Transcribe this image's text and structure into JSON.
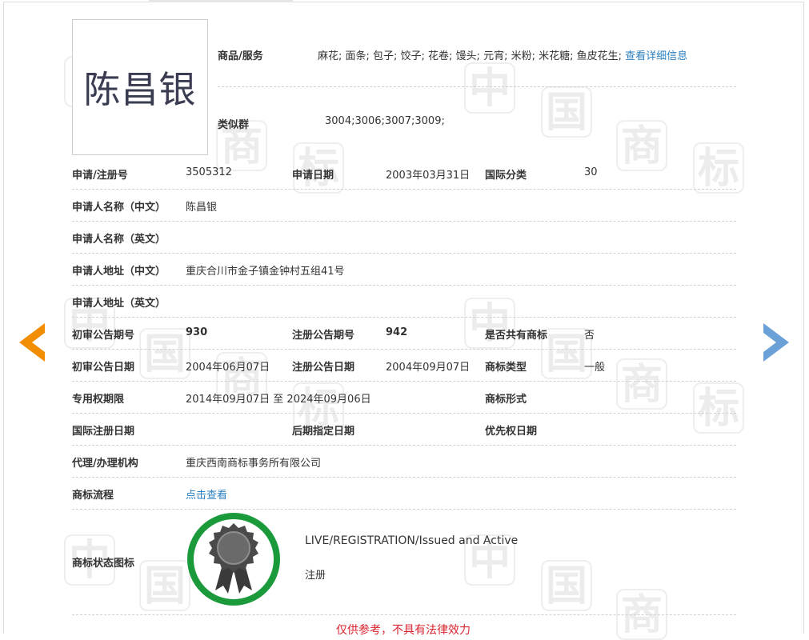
{
  "colors": {
    "accent": "#2a7fc0",
    "badge_ring": "#1a9a3a",
    "prev_arrow": "#f28c00",
    "next_arrow": "#6aa2d8",
    "disclaimer": "#d9232e"
  },
  "trademark": {
    "logo_text": "陈昌银"
  },
  "goods": {
    "label": "商品/服务",
    "value": "麻花; 面条; 包子; 饺子; 花卷; 馒头; 元宵; 米粉; 米花糖; 鱼皮花生;",
    "link": "查看详细信息"
  },
  "similar": {
    "label": "类似群",
    "value": "3004;3006;3007;3009;"
  },
  "rows": [
    {
      "l1": "申请/注册号",
      "v1": "3505312",
      "l2": "申请日期",
      "v2": "2003年03月31日",
      "l3": "国际分类",
      "v3": "30"
    },
    {
      "l1": "申请人名称（中文）",
      "v1": "陈昌银"
    },
    {
      "l1": "申请人名称（英文）",
      "v1": ""
    },
    {
      "l1": "申请人地址（中文）",
      "v1": "重庆合川市金子镇金钟村五组41号"
    },
    {
      "l1": "申请人地址（英文）",
      "v1": ""
    },
    {
      "l1": "初审公告期号",
      "v1": "930",
      "l2": "注册公告期号",
      "v2": "942",
      "l3": "是否共有商标",
      "v3": "否"
    },
    {
      "l1": "初审公告日期",
      "v1": "2004年06月07日",
      "l2": "注册公告日期",
      "v2": "2004年09月07日",
      "l3": "商标类型",
      "v3": "一般"
    },
    {
      "l1": "专用权期限",
      "v1": "2014年09月07日 至 2024年09月06日",
      "l3": "商标形式",
      "v3": ""
    },
    {
      "l1": "国际注册日期",
      "v1": "",
      "l2": "后期指定日期",
      "v2": "",
      "l3": "优先权日期",
      "v3": ""
    },
    {
      "l1": "代理/办理机构",
      "v1": "重庆西南商标事务所有限公司"
    },
    {
      "l1": "商标流程",
      "v1": "点击查看"
    }
  ],
  "status": {
    "label": "商标状态图标",
    "en": "LIVE/REGISTRATION/Issued and Active",
    "cn": "注册"
  },
  "disclaimer": "仅供参考，不具有法律效力",
  "icons": {
    "prev": "arrow-left-icon",
    "next": "arrow-right-icon",
    "badge": "award-ribbon-icon"
  }
}
